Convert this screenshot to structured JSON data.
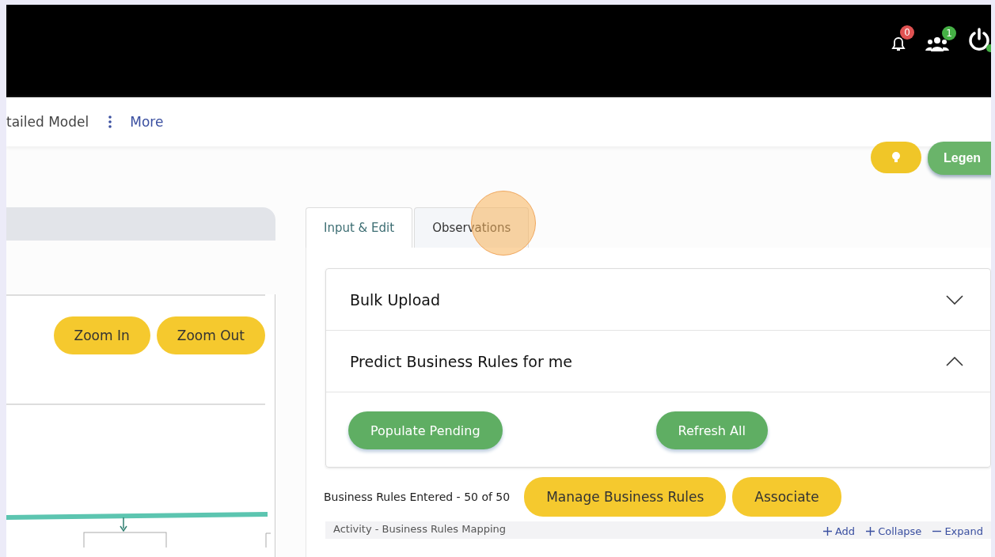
{
  "header": {
    "notifications": {
      "count": "0"
    },
    "users": {
      "count": "1"
    }
  },
  "nav": {
    "items": [
      {
        "label": "tailed Model",
        "kind": "text"
      },
      {
        "label": "More",
        "kind": "more"
      }
    ]
  },
  "toolbar": {
    "legend_button": "Legen"
  },
  "diagram": {
    "buttons": [
      "Zoom In",
      "Zoom Out"
    ]
  },
  "tabs": [
    {
      "label": "Input & Edit",
      "selected": true
    },
    {
      "label": "Observations",
      "selected": false
    }
  ],
  "accordion": [
    {
      "title": "Bulk Upload",
      "expanded": false
    },
    {
      "title": "Predict Business Rules for me",
      "expanded": true,
      "buttons": [
        "Populate Pending",
        "Refresh All"
      ]
    }
  ],
  "rules_bar": {
    "summary": "Business Rules Entered - 50 of 50",
    "buttons": [
      "Manage Business Rules",
      "Associate"
    ]
  },
  "table_header": {
    "title": "Activity - Business Rules Mapping",
    "actions": [
      {
        "kind": "plus",
        "label": "Add"
      },
      {
        "kind": "plus",
        "label": "Collapse"
      },
      {
        "kind": "minus",
        "label": "Expand"
      }
    ]
  }
}
